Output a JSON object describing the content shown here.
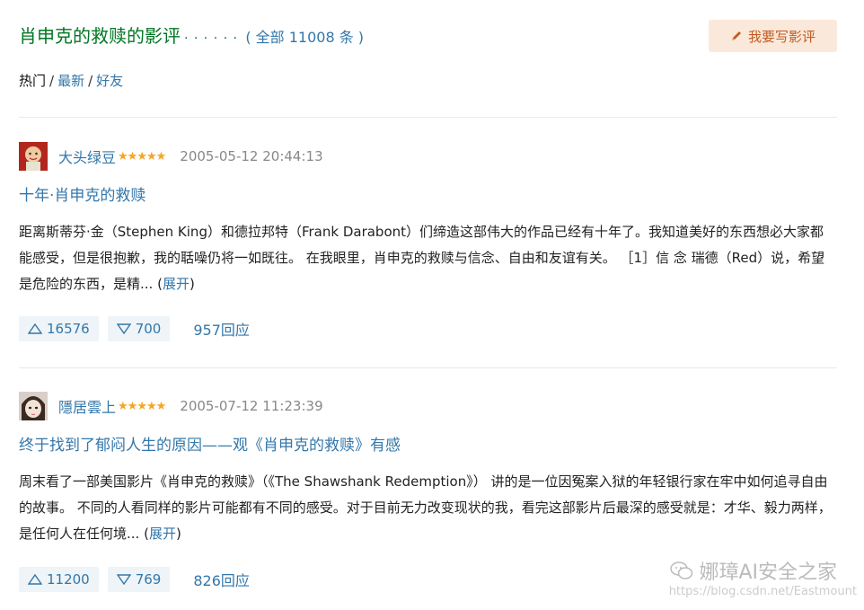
{
  "header": {
    "title": "肖申克的救赎的影评",
    "dots": "· · · · · ·",
    "count": "( 全部 11008 条 )",
    "write_label": "我要写影评"
  },
  "filters": {
    "items": [
      "热门",
      "最新",
      "好友"
    ],
    "separator": "/"
  },
  "reviews": [
    {
      "author": "大头绿豆",
      "stars": "★★★★★",
      "date": "2005-05-12 20:44:13",
      "title": "十年·肖申克的救赎",
      "body": "距离斯蒂芬·金（Stephen King）和德拉邦特（Frank Darabont）们缔造这部伟大的作品已经有十年了。我知道美好的东西想必大家都能感受，但是很抱歉，我的聒噪仍将一如既往。 在我眼里，肖申克的救赎与信念、自由和友谊有关。 ［1］信 念 瑞德（Red）说，希望是危险的东西，是精...",
      "expand_open": " (",
      "expand_label": "展开",
      "expand_close": ")",
      "useful": "16576",
      "useless": "700",
      "replies": "957回应"
    },
    {
      "author": "隱居雲上",
      "stars": "★★★★★",
      "date": "2005-07-12 11:23:39",
      "title": "终于找到了郁闷人生的原因——观《肖申克的救赎》有感",
      "body": "周末看了一部美国影片《肖申克的救赎》（《The Shawshank Redemption》） 讲的是一位因冤案入狱的年轻银行家在牢中如何追寻自由的故事。 不同的人看同样的影片可能都有不同的感受。对于目前无力改变现状的我，看完这部影片后最深的感受就是：才华、毅力两样，是任何人在任何境...",
      "expand_open": " (",
      "expand_label": "展开",
      "expand_close": ")",
      "useful": "11200",
      "useless": "769",
      "replies": "826回应"
    }
  ],
  "watermark": {
    "text": "娜璋AI安全之家",
    "url": "https://blog.csdn.net/Eastmount"
  },
  "colors": {
    "title_green": "#007722",
    "link_blue": "#3377aa",
    "star_orange": "#f5a623",
    "button_bg": "#fae9da"
  }
}
